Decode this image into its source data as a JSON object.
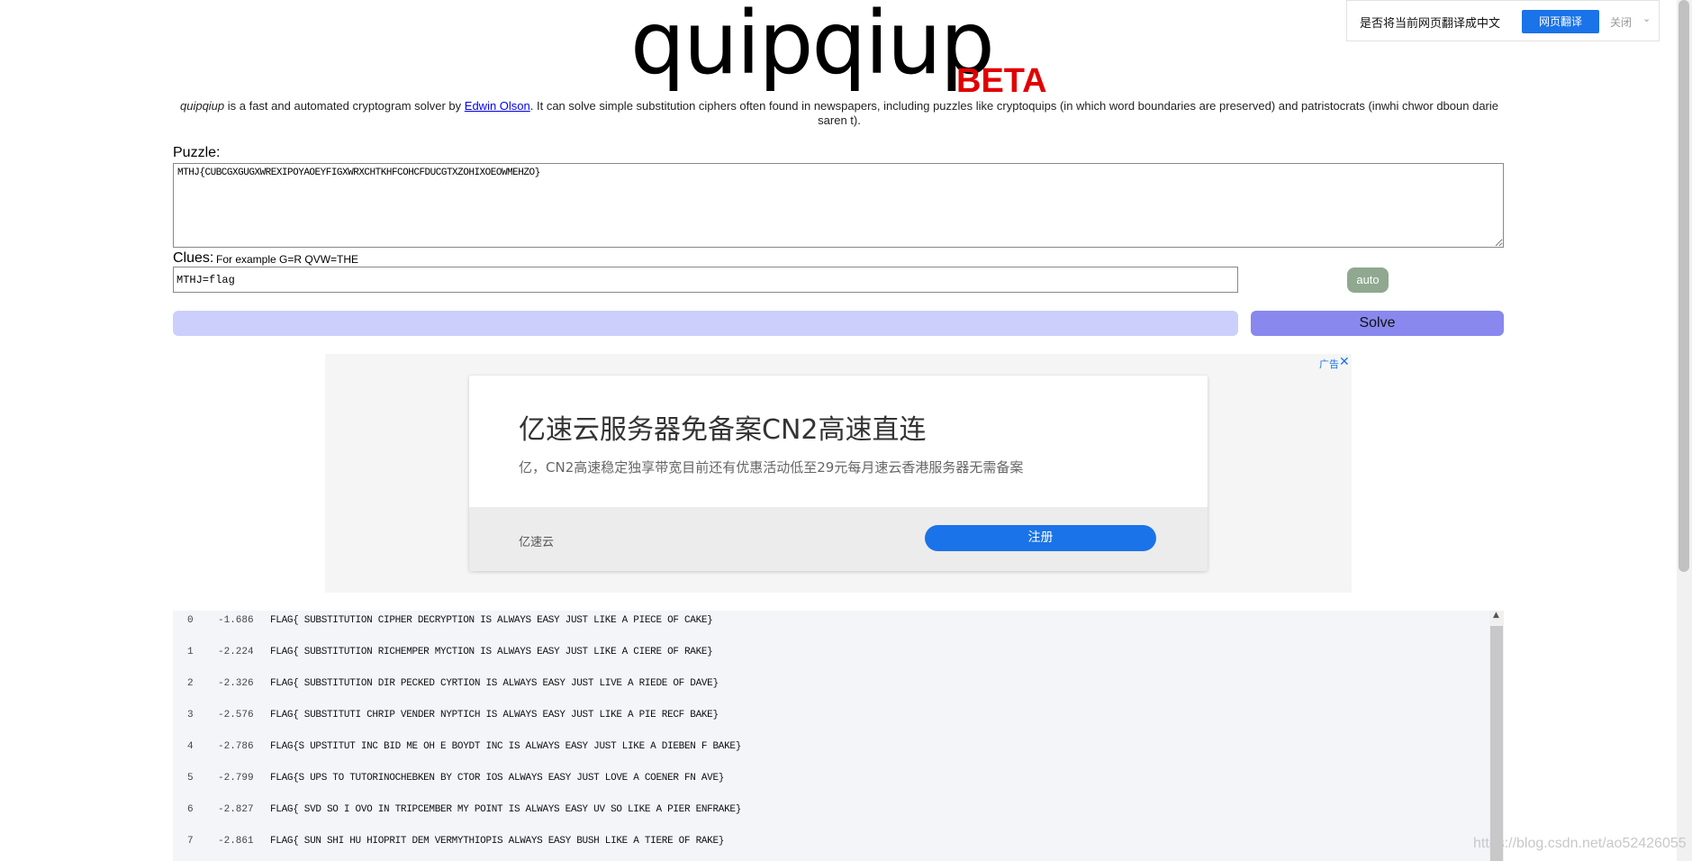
{
  "header": {
    "logo": "quipqiup",
    "beta": "BETA"
  },
  "translate_bar": {
    "prompt": "是否将当前网页翻译成中文",
    "translate_button": "网页翻译",
    "close_label": "关闭",
    "chevron": "⌄"
  },
  "description": {
    "app_name": "quipqiup",
    "part1": " is a fast and automated cryptogram solver by ",
    "author": "Edwin Olson",
    "part2": ". It can solve simple substitution ciphers often found in newspapers, including puzzles like cryptoquips (in which word boundaries are preserved) and patristocrats (inwhi chwor dboun darie saren t)."
  },
  "puzzle": {
    "label": "Puzzle:",
    "value": "MTHJ{CUBCGXGUGXWREXIPOYAOEYFIGXWRXCHTKHFCOHCFDUCGTXZOHIXOEOWMEHZO}"
  },
  "clues": {
    "label": "Clues:",
    "example": "For example G=R QVW=THE",
    "value": "MTHJ=flag",
    "auto_button": "auto"
  },
  "solve_button": "Solve",
  "ad": {
    "badge": "广告",
    "close": "✕",
    "title": "亿速云服务器免备案CN2高速直连",
    "subtitle": "亿，CN2高速稳定独享带宽目前还有优惠活动低至29元每月速云香港服务器无需备案",
    "brand": "亿速云",
    "cta": "注册"
  },
  "results": [
    {
      "rank": "0",
      "score": "-1.686",
      "text": "FLAG{ SUBSTITUTION CIPHER DECRYPTION IS ALWAYS EASY JUST LIKE A PIECE OF CAKE}"
    },
    {
      "rank": "1",
      "score": "-2.224",
      "text": "FLAG{ SUBSTITUTION RICHEMPER MYCTION IS ALWAYS EASY JUST LIKE A CIERE OF RAKE}"
    },
    {
      "rank": "2",
      "score": "-2.326",
      "text": "FLAG{ SUBSTITUTION DIR PECKED CYRTION IS ALWAYS EASY JUST LIVE A RIEDE OF DAVE}"
    },
    {
      "rank": "3",
      "score": "-2.576",
      "text": "FLAG{ SUBSTITUTI CHRIP VENDER NYPTICH IS ALWAYS EASY JUST LIKE A PIE RECF BAKE}"
    },
    {
      "rank": "4",
      "score": "-2.786",
      "text": "FLAG{S UPSTITUT INC BID ME OH E BOYDT INC IS ALWAYS EASY JUST LIKE A DIEBEN F BAKE}"
    },
    {
      "rank": "5",
      "score": "-2.799",
      "text": "FLAG{S UPS TO TUTORINOCHEBKEN BY CTOR IOS ALWAYS EASY JUST LOVE A COENER FN AVE}"
    },
    {
      "rank": "6",
      "score": "-2.827",
      "text": "FLAG{ SVD SO I OVO IN TRIPCEMBER MY POINT IS ALWAYS EASY UV SO LIKE A PIER ENFRAKE}"
    },
    {
      "rank": "7",
      "score": "-2.861",
      "text": "FLAG{ SUN SHI HU HIOPRIT DEM VERMYTHIOPIS ALWAYS EASY BUSH LIKE A TIERE OF RAKE}"
    }
  ],
  "watermark": "https://blog.csdn.net/ao52426055"
}
